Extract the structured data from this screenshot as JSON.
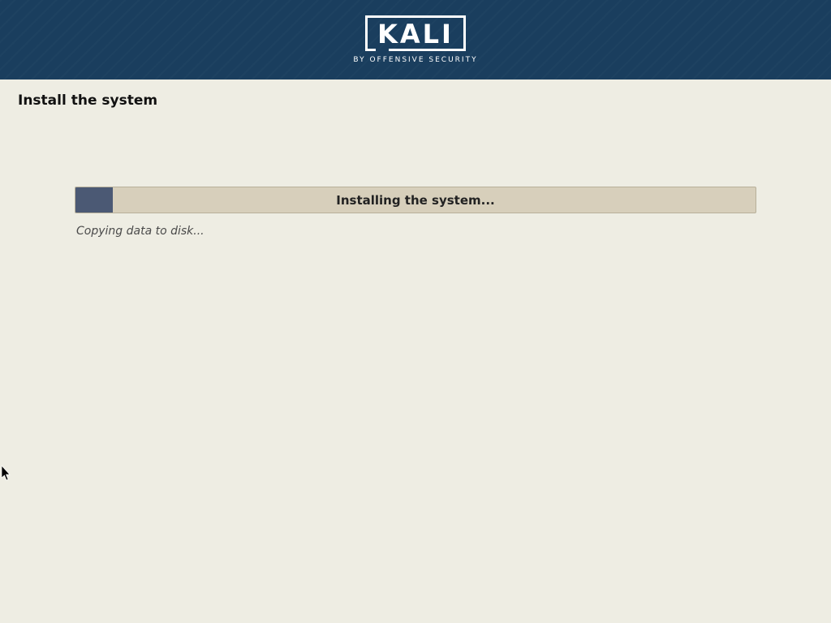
{
  "header": {
    "logo_text": "KALI",
    "logo_subtitle": "BY OFFENSIVE SECURITY"
  },
  "page": {
    "title": "Install the system"
  },
  "progress": {
    "label": "Installing the system...",
    "status": "Copying data to disk...",
    "percent": 5.5
  },
  "colors": {
    "header_bg": "#1a3e5e",
    "page_bg": "#eeede3",
    "progress_track": "#d7cfbb",
    "progress_fill": "#4b5974"
  }
}
